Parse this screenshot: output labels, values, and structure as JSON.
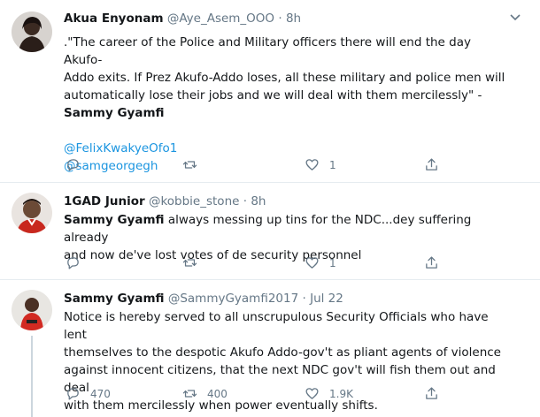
{
  "tweets": [
    {
      "name": "Akua Enyonam",
      "handle": "@Aye_Asem_OOO",
      "time": "8h",
      "text_lines": [
        ".\"The career of the Police and Military officers there will end the day Akufo-",
        "Addo exits. If Prez Akufo-Addo loses, all these military and police men will",
        "automatically lose their jobs and we will deal with them mercilessly\" -"
      ],
      "signature": "Sammy Gyamfi",
      "mentions": [
        "@FelixKwakyeOfo1",
        "@samgeorgegh"
      ],
      "replies": "",
      "retweets": "",
      "likes": "1"
    },
    {
      "name": "1GAD Junior",
      "handle": "@kobbie_stone",
      "time": "8h",
      "lead_bold": "Sammy Gyamfi",
      "text_line1": " always messing up tins for the NDC...dey suffering already",
      "text_line2": "and now de've lost votes of de security personnel",
      "replies": "",
      "retweets": "",
      "likes": "1"
    },
    {
      "name": "Sammy Gyamfi",
      "handle": "@SammyGyamfi2017",
      "time": "Jul 22",
      "text_lines": [
        "Notice is hereby served to all unscrupulous Security Officials who have lent",
        "themselves to the despotic Akufo Addo-gov't as pliant agents of violence",
        "against innocent citizens, that the next NDC gov't will fish them out and deal",
        "with them mercilessly when power eventually shifts."
      ],
      "replies": "470",
      "retweets": "400",
      "likes": "1.9K"
    }
  ],
  "separator_dot": "·",
  "colors": {
    "link": "#1b95e0",
    "muted": "#657786",
    "divider": "#e6ecf0"
  }
}
